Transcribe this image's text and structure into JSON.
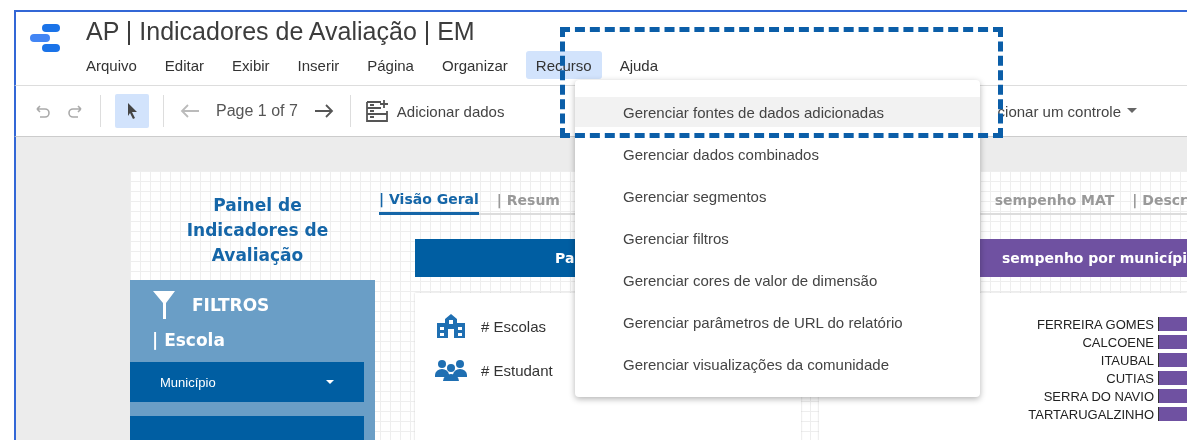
{
  "app": {
    "title": "AP | Indicadores de Avaliação | EM"
  },
  "menu_bar": [
    {
      "label": "Arquivo",
      "selected": false
    },
    {
      "label": "Editar",
      "selected": false
    },
    {
      "label": "Exibir",
      "selected": false
    },
    {
      "label": "Inserir",
      "selected": false
    },
    {
      "label": "Página",
      "selected": false
    },
    {
      "label": "Organizar",
      "selected": false
    },
    {
      "label": "Recurso",
      "selected": true
    },
    {
      "label": "Ajuda",
      "selected": false
    }
  ],
  "toolbar": {
    "page_indicator": "Page 1 of 7",
    "add_data_button": "Adicionar dados",
    "add_control_button": "cionar um controle"
  },
  "report": {
    "title": "Painel de Indicadores de Avaliação",
    "tabs": [
      {
        "label": "| Visão Geral",
        "selected": true
      },
      {
        "label": "| Resum",
        "selected": false
      },
      {
        "label": "sempenho MAT",
        "selected": false
      },
      {
        "label": "| Descr",
        "selected": false
      }
    ],
    "filters": {
      "heading": "FILTROS",
      "section": "| Escola",
      "dropdowns": [
        "Município"
      ]
    },
    "panel_headers": [
      {
        "text": "Pa",
        "color": "#005ea2"
      },
      {
        "text": "sempenho por municípi",
        "color": "#6f51a1"
      }
    ],
    "kpis": [
      {
        "kind": "school",
        "label": "# Escolas"
      },
      {
        "kind": "people",
        "label": "# Estudant"
      }
    ],
    "chart_labels": [
      "FERREIRA GOMES",
      "CALCOENE",
      "ITAUBAL",
      "CUTIAS",
      "SERRA DO NAVIO",
      "TARTARUGALZINHO"
    ]
  },
  "dropdown_menu": {
    "items": [
      {
        "label": "Gerenciar fontes de dados adicionadas",
        "selected": true
      },
      {
        "label": "Gerenciar dados combinados",
        "selected": false
      },
      {
        "label": "Gerenciar segmentos",
        "selected": false
      },
      {
        "label": "Gerenciar filtros",
        "selected": false
      },
      {
        "label": "Gerenciar cores de valor de dimensão",
        "selected": false
      },
      {
        "label": "Gerenciar parâmetros de URL do relatório",
        "selected": false
      },
      {
        "label": "Gerenciar visualizações da comunidade",
        "selected": false
      }
    ]
  }
}
